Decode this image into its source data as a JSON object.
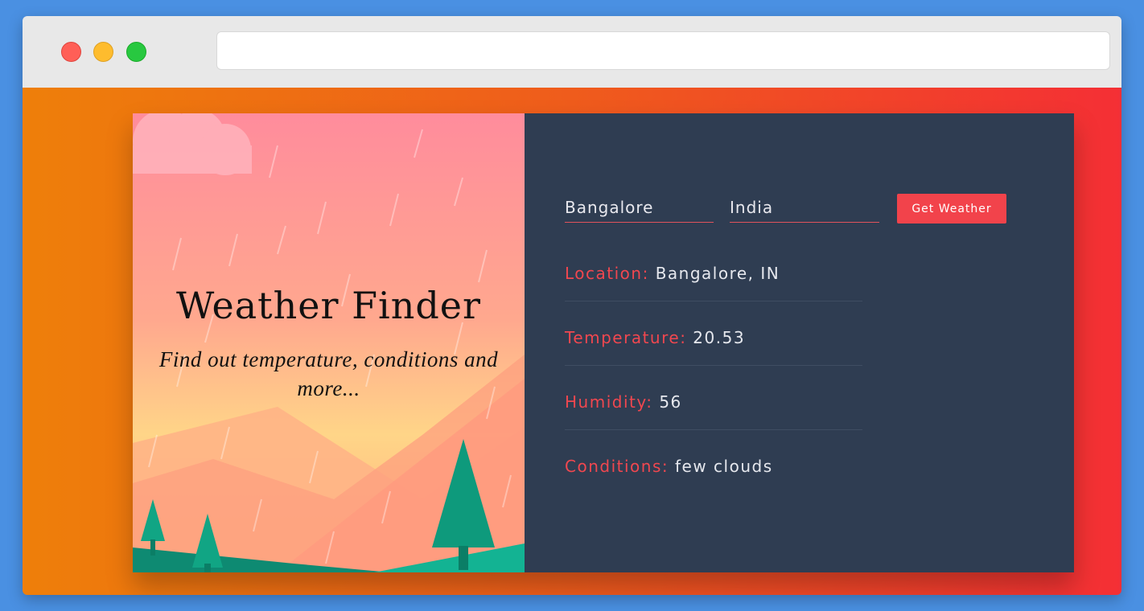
{
  "hero": {
    "title": "Weather Finder",
    "subtitle": "Find out temperature, conditions and more..."
  },
  "form": {
    "city_value": "Bangalore",
    "country_value": "India",
    "button_label": "Get Weather"
  },
  "results": {
    "location_label": "Location:",
    "location_value": "Bangalore, IN",
    "temperature_label": "Temperature:",
    "temperature_value": "20.53",
    "humidity_label": "Humidity:",
    "humidity_value": "56",
    "conditions_label": "Conditions:",
    "conditions_value": "few clouds"
  },
  "colors": {
    "accent": "#f2434b",
    "panel": "#2f3d52",
    "page_gradient_start": "#ee7f0a",
    "page_gradient_end": "#f42f35"
  }
}
